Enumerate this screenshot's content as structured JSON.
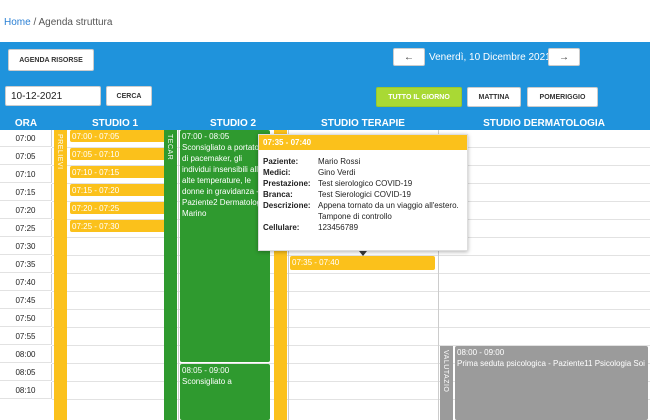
{
  "breadcrumb": {
    "home": "Home",
    "sep": "/",
    "current": "Agenda struttura"
  },
  "toolbar": {
    "agenda_risorse": "AGENDA RISORSE",
    "prev": "←",
    "current_date": "Venerdì, 10 Dicembre 2021",
    "next": "→",
    "date_input_value": "10-12-2021",
    "cerca": "CERCA",
    "tutto_il_giorno": "TUTTO IL GIORNO",
    "mattina": "MATTINA",
    "pomeriggio": "POMERIGGIO"
  },
  "columns": {
    "ora": "ORA",
    "studio1": "STUDIO 1",
    "studio2": "STUDIO 2",
    "studio_terapie": "STUDIO TERAPIE",
    "studio_dermatologia": "STUDIO DERMATOLOGIA"
  },
  "times": [
    "07:00",
    "07:05",
    "07:10",
    "07:15",
    "07:20",
    "07:25",
    "07:30",
    "07:35",
    "07:40",
    "07:45",
    "07:50",
    "07:55",
    "08:00",
    "08:05",
    "08:10"
  ],
  "strips": {
    "prelievi": "PRELIEVI",
    "tecar": "TECAR",
    "valutazioni": "VALUTAZIO"
  },
  "events": {
    "s1": [
      "07:00 - 07:05",
      "07:05 - 07:10",
      "07:10 - 07:15",
      "07:15 - 07:20",
      "07:20 - 07:25",
      "07:25 - 07:30"
    ],
    "s2a": {
      "time": "07:00 - 08:05",
      "text": "Sconsigliato a portatori di pacemaker, gli individui insensibili alle alte temperature, le donne in gravidanza - Paziente2 Dermatologia Marino"
    },
    "s2b": {
      "time": "08:05 - 09:00",
      "text": "Sconsigliato a"
    },
    "st": {
      "time": "07:35 - 07:40"
    },
    "sd": {
      "time": "08:00 - 09:00",
      "text": "Prima seduta psicologica - Paziente11 Psicologia Soi"
    }
  },
  "tooltip": {
    "header": "07:35 - 07:40",
    "paziente_k": "Paziente:",
    "paziente_v": "Mario Rossi",
    "medici_k": "Medici:",
    "medici_v": "Gino Verdi",
    "prestazione_k": "Prestazione:",
    "prestazione_v": "Test sierologico COVID-19",
    "branca_k": "Branca:",
    "branca_v": "Test Sierologici COVID-19",
    "descrizione_k": "Descrizione:",
    "descrizione_v": "Appena tornato da un viaggio all'estero. Tampone di controllo",
    "cellulare_k": "Cellulare:",
    "cellulare_v": "123456789"
  },
  "colors": {
    "accent": "#1f93dc",
    "yellow": "#fbc11b",
    "green": "#2f9a2f",
    "gray": "#9b9b9b",
    "lime": "#a9d934"
  }
}
